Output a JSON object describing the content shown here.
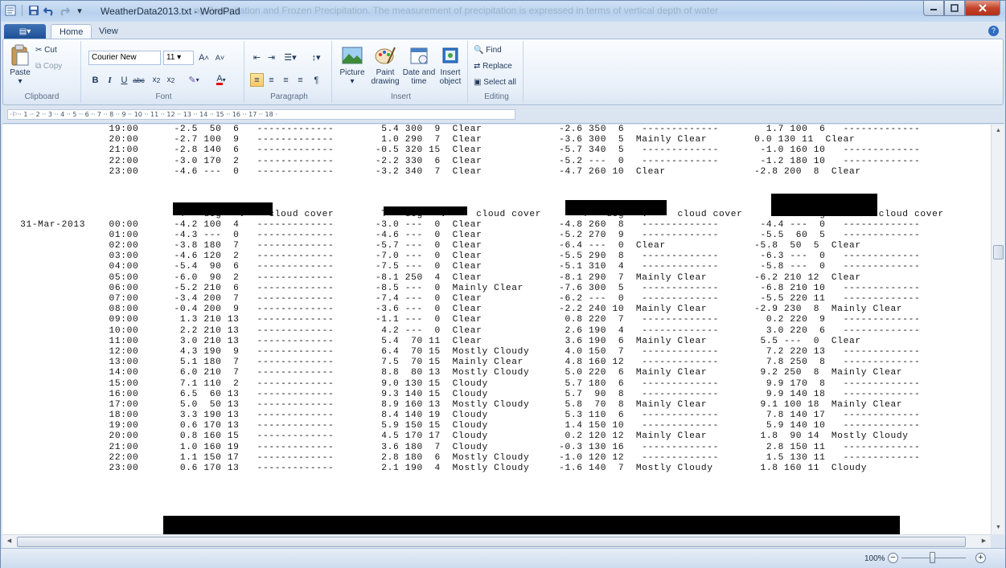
{
  "window": {
    "title": "WeatherData2013.txt - WordPad",
    "background_title": "ng Precipitation and Frozen Precipitation. The measurement of precipitation is expressed in terms of vertical depth of water"
  },
  "tabs": {
    "app": "▤▾",
    "home": "Home",
    "view": "View"
  },
  "clipboard": {
    "paste": "Paste",
    "cut": "Cut",
    "copy": "Copy",
    "label": "Clipboard"
  },
  "font": {
    "family": "Courier New",
    "size": "11",
    "label": "Font"
  },
  "paragraph": {
    "label": "Paragraph"
  },
  "insert": {
    "picture": "Picture",
    "paint": "Paint\ndrawing",
    "datetime": "Date and\ntime",
    "object": "Insert\nobject",
    "label": "Insert"
  },
  "editing": {
    "find": "Find",
    "replace": "Replace",
    "select_all": "Select all",
    "label": "Editing"
  },
  "ruler": "·⚐·· 1 ·· 2 ·· 3 ·· 4 ·· 5 ·· 6 ·· 7 ·· 8 ·· 9 ·· 10 ·· 11 ·· 12 ·· 13 ·· 14 ·· 15 ·· 16 ·· 17 ·· 18 ·",
  "document_lines": [
    "                  19:00      -2.5  50  6   -------------        5.4 300  9  Clear             -2.6 350  6   -------------        1.7 100  6   -------------",
    "                  20:00      -2.7 100  9   -------------        1.0 290  7  Clear             -3.6 300  5  Mainly Clear        0.0 130 11  Clear",
    "                  21:00      -2.8 140  6   -------------       -0.5 320 15  Clear             -5.7 340  5   -------------       -1.0 160 10   -------------",
    "                  22:00      -3.0 170  2   -------------       -2.2 330  6  Clear             -5.2 ---  0   -------------       -1.2 180 10   -------------",
    "                  23:00      -4.6 ---  0   -------------       -3.2 340  7  Clear             -4.7 260 10  Clear               -2.8 200  8  Clear",
    "",
    "",
    "",
    "                              T   deg   v    cloud cover        T   deg   v     cloud cover       T   deg   v     cloud cover       T   deg   v     cloud cover",
    "   31-Mar-2013    00:00      -4.2 100  4   -------------       -3.0 ---  0  Clear             -4.8 260  8   -------------       -4.4 ---  0   -------------",
    "                  01:00      -4.3 ---  0   -------------       -4.6 ---  0  Clear             -5.2 270  9   -------------       -5.5  60  5   -------------",
    "                  02:00      -3.8 180  7   -------------       -5.7 ---  0  Clear             -6.4 ---  0  Clear               -5.8  50  5  Clear",
    "                  03:00      -4.6 120  2   -------------       -7.0 ---  0  Clear             -5.5 290  8   -------------       -6.3 ---  0   -------------",
    "                  04:00      -5.4  90  6   -------------       -7.5 ---  0  Clear             -5.1 310  4   -------------       -5.8 ---  0   -------------",
    "                  05:00      -6.0  90  2   -------------       -8.1 250  4  Clear             -8.1 290  7  Mainly Clear        -6.2 210 12  Clear",
    "                  06:00      -5.2 210  6   -------------       -8.5 ---  0  Mainly Clear      -7.6 300  5   -------------       -6.8 210 10   -------------",
    "                  07:00      -3.4 200  7   -------------       -7.4 ---  0  Clear             -6.2 ---  0   -------------       -5.5 220 11   -------------",
    "                  08:00      -0.4 200  9   -------------       -3.6 ---  0  Clear             -2.2 240 10  Mainly Clear        -2.9 230  8  Mainly Clear",
    "                  09:00       1.3 210 13   -------------       -1.1 ---  0  Clear              0.8 220  7   -------------        0.2 220  9   -------------",
    "                  10:00       2.2 210 13   -------------        4.2 ---  0  Clear              2.6 190  4   -------------        3.0 220  6   -------------",
    "                  11:00       3.0 210 13   -------------        5.4  70 11  Clear              3.6 190  6  Mainly Clear         5.5 ---  0  Clear",
    "                  12:00       4.3 190  9   -------------        6.4  70 15  Mostly Cloudy      4.0 150  7   -------------        7.2 220 13   -------------",
    "                  13:00       5.1 180  7   -------------        7.5  70 15  Mainly Clear       4.8 160 12   -------------        7.8 250  8   -------------",
    "                  14:00       6.0 210  7   -------------        8.8  80 13  Mostly Cloudy      5.0 220  6  Mainly Clear         9.2 250  8  Mainly Clear",
    "                  15:00       7.1 110  2   -------------        9.0 130 15  Cloudy             5.7 180  6   -------------        9.9 170  8   -------------",
    "                  16:00       6.5  60 13   -------------        9.3 140 15  Cloudy             5.7  90  8   -------------        9.9 140 18   -------------",
    "                  17:00       5.0  50 13   -------------        8.9 160 13  Mostly Cloudy      5.8  70  8  Mainly Clear         9.1 100 18  Mainly Clear",
    "                  18:00       3.3 190 13   -------------        8.4 140 19  Cloudy             5.3 110  6   -------------        7.8 140 17   -------------",
    "                  19:00       0.6 170 13   -------------        5.9 150 15  Cloudy             1.4 150 10   -------------        5.9 140 10   -------------",
    "                  20:00       0.8 160 15   -------------        4.5 170 17  Cloudy             0.2 120 12  Mainly Clear         1.8  90 14  Mostly Cloudy",
    "                  21:00       1.0 160 19   -------------        3.6 180  7  Cloudy            -0.3 130 16   -------------        2.8 150 11   -------------",
    "                  22:00       1.1 150 17   -------------        2.8 180  6  Mostly Cloudy     -1.0 120 12   -------------        1.5 130 11   -------------",
    "                  23:00       0.6 170 13   -------------        2.1 190  4  Mostly Cloudy     -1.6 140  7  Mostly Cloudy        1.8 160 11  Cloudy"
  ],
  "status": {
    "zoom": "100%"
  }
}
